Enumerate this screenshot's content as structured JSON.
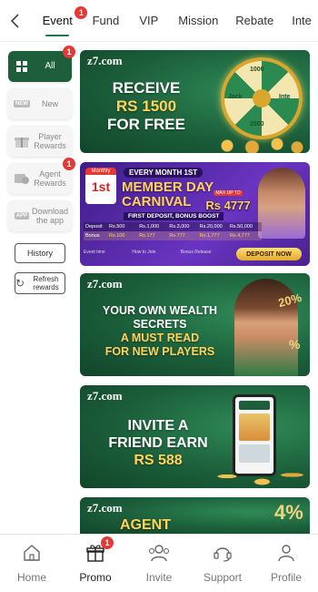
{
  "tabs": [
    {
      "label": "Event",
      "badge": "1"
    },
    {
      "label": "Fund"
    },
    {
      "label": "VIP"
    },
    {
      "label": "Mission"
    },
    {
      "label": "Rebate"
    },
    {
      "label": "Inte"
    }
  ],
  "sidebar": {
    "items": [
      {
        "label": "All",
        "badge": "1"
      },
      {
        "label": "New",
        "icon_text": "NEW"
      },
      {
        "label": "Player Rewards"
      },
      {
        "label": "Agent Rewards",
        "badge": "1"
      },
      {
        "label": "Download the app",
        "icon_text": "APP"
      }
    ],
    "history_label": "History",
    "refresh_label": "Refresh rewards"
  },
  "banners": {
    "b1": {
      "logo": "z7.com",
      "line1": "RECEIVE",
      "line2": "RS 1500",
      "line3": "FOR FREE",
      "wheel_labels": [
        "1000",
        "Jack",
        "2500",
        "Inte"
      ]
    },
    "b2": {
      "badge_top": "Monthly",
      "badge_num": "1st",
      "kicker": "EVERY MONTH 1ST",
      "title1": "MEMBER DAY",
      "title2": "CARNIVAL",
      "bonus_chip": "Rs 4777",
      "bonus_chip_top": "MAX UP TO",
      "subtitle": "FIRST DEPOSIT, BONUS BOOST",
      "deposit_label": "Deposit",
      "deposit_values": [
        "Rs.500",
        "Rs.1,000",
        "Rs.3,000",
        "Rs.20,000",
        "Rs.50,000"
      ],
      "bonus_label": "Bonus",
      "bonus_values": [
        "Rs.100",
        "Rs.177",
        "Rs.777",
        "Rs.1,777",
        "Rs.4,777"
      ],
      "info": [
        "Event time",
        "How to Join",
        "Bonus Release"
      ],
      "cta": "DEPOSIT NOW"
    },
    "b3": {
      "logo": "z7.com",
      "line1": "YOUR OWN WEALTH",
      "line2": "SECRETS",
      "line3": "A MUST READ",
      "line4": "FOR NEW PLAYERS",
      "percent_a": "20%",
      "percent_b": "%"
    },
    "b4": {
      "logo": "z7.com",
      "line1": "INVITE A",
      "line2": "FRIEND EARN",
      "line3": "RS 588"
    },
    "b5": {
      "logo": "z7.com",
      "line1": "AGENT",
      "percent": "4%"
    }
  },
  "bottomnav": [
    {
      "label": "Home",
      "icon": "home-icon"
    },
    {
      "label": "Promo",
      "icon": "gift-icon",
      "badge": "1"
    },
    {
      "label": "Invite",
      "icon": "invite-icon"
    },
    {
      "label": "Support",
      "icon": "headset-icon"
    },
    {
      "label": "Profile",
      "icon": "profile-icon"
    }
  ],
  "colors": {
    "accent_green": "#1f5e3a",
    "badge_red": "#e53935",
    "gold": "#ffd25a",
    "purple": "#5a2ea6"
  }
}
